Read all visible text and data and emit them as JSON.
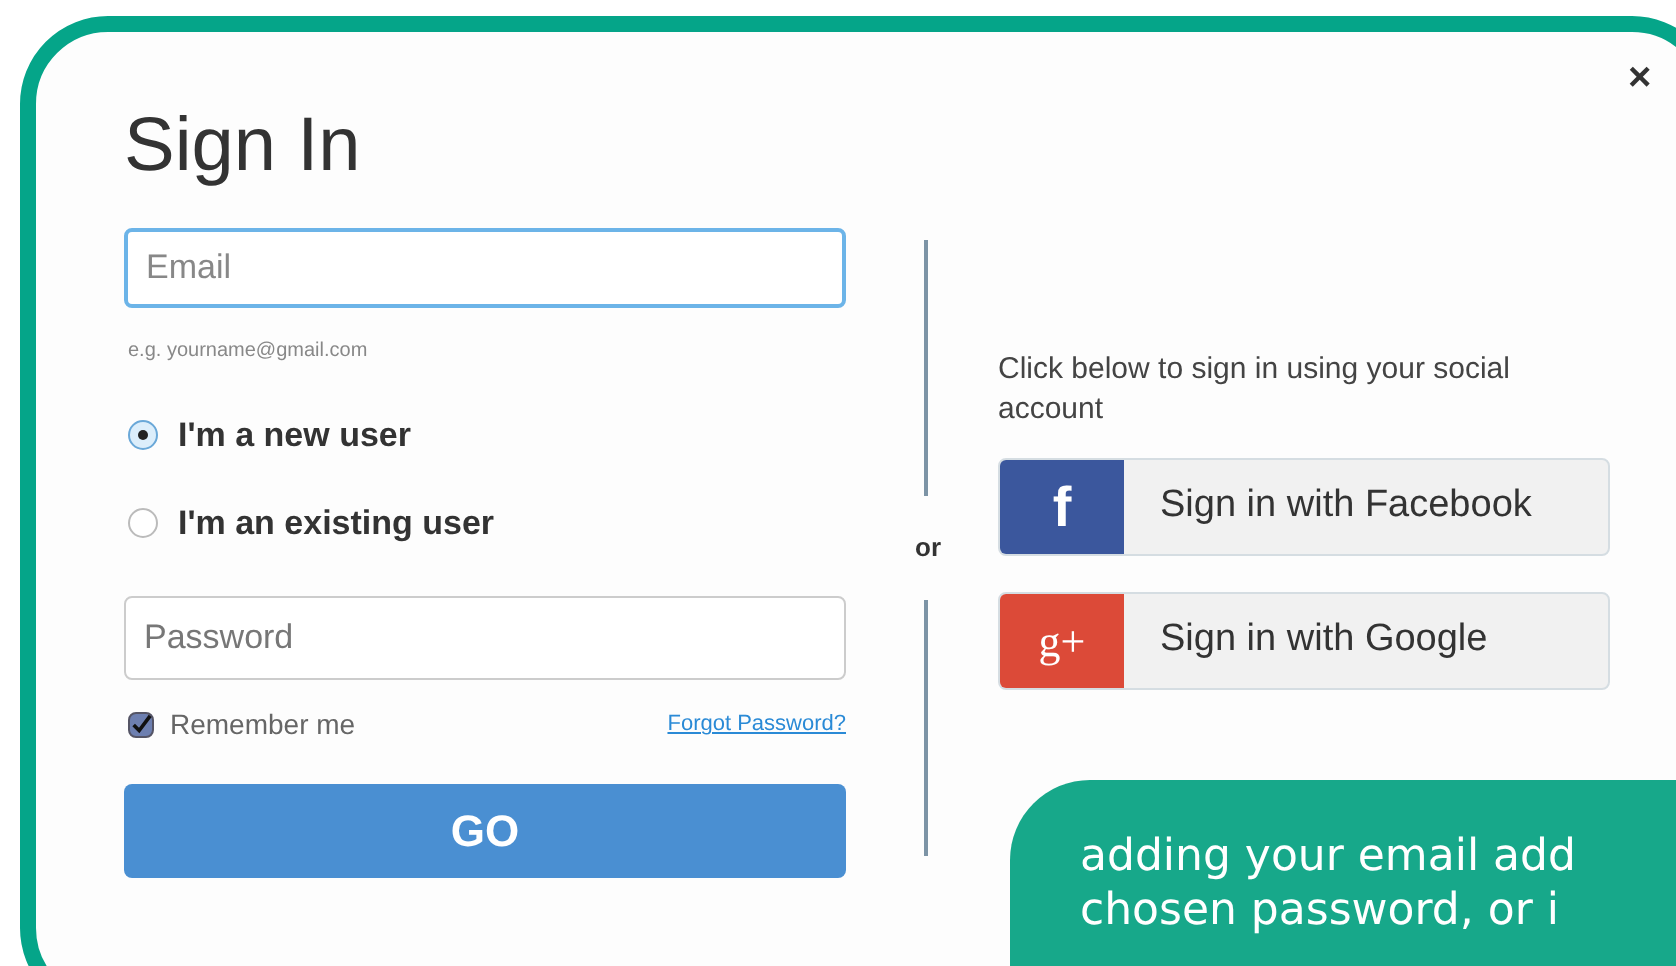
{
  "dialog": {
    "title": "Sign In",
    "close": "×"
  },
  "email": {
    "placeholder": "Email",
    "hint": "e.g. yourname@gmail.com",
    "focused": true
  },
  "user_type": [
    {
      "label": "I'm a new user",
      "selected": true
    },
    {
      "label": "I'm an existing user",
      "selected": false
    }
  ],
  "password": {
    "placeholder": "Password"
  },
  "remember": {
    "label": "Remember me",
    "checked": true
  },
  "forgot_link": "Forgot Password?",
  "submit": "GO",
  "divider": "or",
  "social": {
    "intro": "Click below to sign in using your social account",
    "buttons": [
      {
        "kind": "facebook",
        "icon": "f",
        "label": "Sign in with Facebook"
      },
      {
        "kind": "google",
        "icon": "g+",
        "label": "Sign in with Google"
      }
    ]
  },
  "callout": {
    "lines": [
      "adding your email add",
      "chosen password, or i"
    ]
  }
}
